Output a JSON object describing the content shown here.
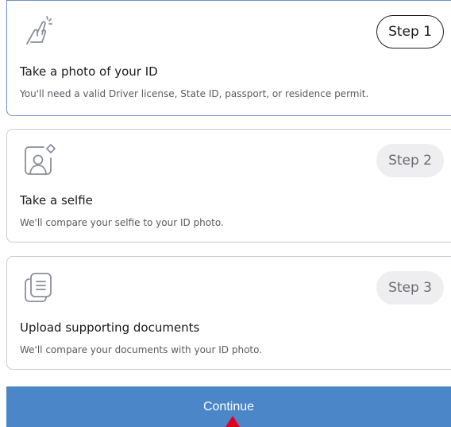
{
  "steps": [
    {
      "icon": "hand-tap-icon",
      "badge": "Step 1",
      "title": "Take a photo of your ID",
      "description": "You'll need a valid Driver license, State ID, passport, or residence permit.",
      "active": true
    },
    {
      "icon": "selfie-portrait-icon",
      "badge": "Step 2",
      "title": "Take a selfie",
      "description": "We'll compare your selfie to your ID photo.",
      "active": false
    },
    {
      "icon": "documents-icon",
      "badge": "Step 3",
      "title": "Upload supporting documents",
      "description": "We'll compare your documents with your ID photo.",
      "active": false
    }
  ],
  "continue_button": {
    "label": "Continue"
  },
  "colors": {
    "primary": "#4a86c8",
    "active_border": "#6f8fbf",
    "inactive_badge_bg": "#eeeef1",
    "icon_stroke": "#8a8f9c",
    "cursor": "#e0001b"
  }
}
